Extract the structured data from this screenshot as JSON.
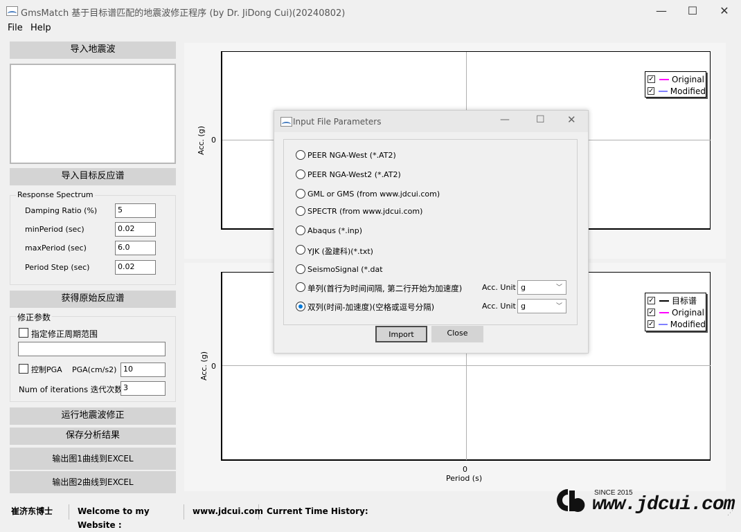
{
  "window": {
    "title": "GmsMatch 基于目标谱匹配的地震波修正程序 (by Dr. JiDong Cui)(20240802)",
    "minimize": "—",
    "maximize": "☐",
    "close": "✕"
  },
  "menu": [
    "File",
    "Help"
  ],
  "left": {
    "import_wave": "导入地震波",
    "import_target": "导入目标反应谱",
    "response_group": "Response Spectrum",
    "fields": [
      {
        "label": "Damping Ratio (%)",
        "value": "5"
      },
      {
        "label": "minPeriod (sec)",
        "value": "0.02"
      },
      {
        "label": "maxPeriod (sec)",
        "value": "6.0"
      },
      {
        "label": "Period Step (sec)",
        "value": "0.02"
      }
    ],
    "get_original": "获得原始反应谱",
    "modify_group": "修正参数",
    "specify_range": "指定修正周期范围",
    "range_value": "",
    "control_pga": "控制PGA",
    "pga_label": "PGA(cm/s2)",
    "pga_value": "10",
    "iter_label": "Num of iterations 迭代次数",
    "iter_value": "3",
    "run": "运行地震波修正",
    "save": "保存分析结果",
    "export1": "输出图1曲线到EXCEL",
    "export2": "输出图2曲线到EXCEL"
  },
  "chart1": {
    "ylabel": "Acc. (g)",
    "ytick": "0",
    "legend": [
      {
        "name": "Original",
        "color": "#ff00ff",
        "checked": true
      },
      {
        "name": "Modified",
        "color": "#8080ff",
        "checked": true
      }
    ]
  },
  "chart2": {
    "ylabel": "Acc. (g)",
    "ytick": "0",
    "xtick": "0",
    "xlabel": "Period (s)",
    "legend": [
      {
        "name": "目标谱",
        "color": "#000000",
        "checked": true
      },
      {
        "name": "Original",
        "color": "#ff00ff",
        "checked": true
      },
      {
        "name": "Modified",
        "color": "#8080ff",
        "checked": true
      }
    ]
  },
  "dialog": {
    "title": "Input File Parameters",
    "options": [
      "PEER NGA-West (*.AT2)",
      "PEER NGA-West2 (*.AT2)",
      "GML or GMS (from www.jdcui.com)",
      "SPECTR (from www.jdcui.com)",
      "Abaqus (*.inp)",
      "YJK (盈建科)(*.txt)",
      "SeismoSignal (*.dat",
      "单列(首行为时间间隔, 第二行开始为加速度)",
      "双列(时间-加速度)(空格或逗号分隔)"
    ],
    "selected_index": 8,
    "acc_unit_label": "Acc. Unit",
    "acc_unit_value_1": "g",
    "acc_unit_value_2": "g",
    "import": "Import",
    "close": "Close"
  },
  "status": {
    "author": "崔济东博士",
    "welcome": "Welcome to my Website :",
    "site": "www.jdcui.com",
    "history": "Current Time History:"
  },
  "watermark": {
    "since": "SINCE 2015",
    "site": "www.jdcui.com"
  }
}
